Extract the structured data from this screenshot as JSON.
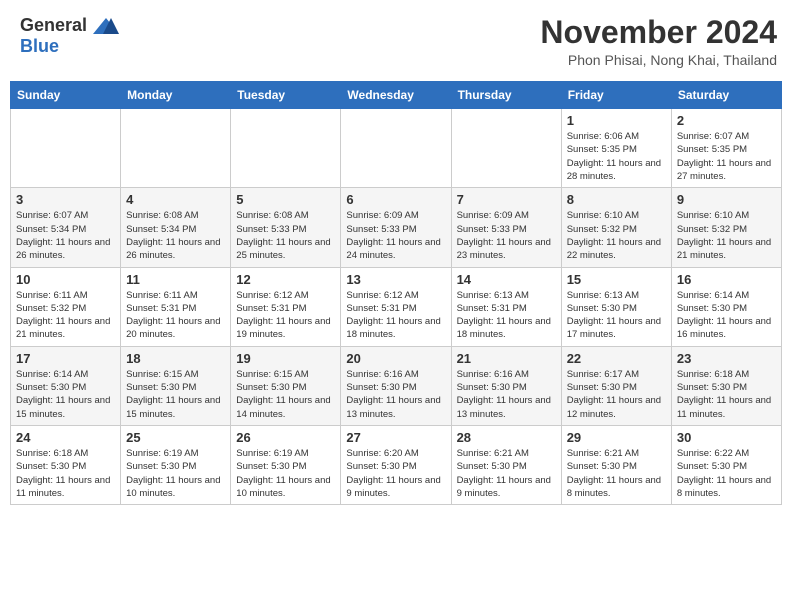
{
  "header": {
    "logo_general": "General",
    "logo_blue": "Blue",
    "month": "November 2024",
    "location": "Phon Phisai, Nong Khai, Thailand"
  },
  "days_of_week": [
    "Sunday",
    "Monday",
    "Tuesday",
    "Wednesday",
    "Thursday",
    "Friday",
    "Saturday"
  ],
  "weeks": [
    [
      {
        "day": "",
        "info": ""
      },
      {
        "day": "",
        "info": ""
      },
      {
        "day": "",
        "info": ""
      },
      {
        "day": "",
        "info": ""
      },
      {
        "day": "",
        "info": ""
      },
      {
        "day": "1",
        "info": "Sunrise: 6:06 AM\nSunset: 5:35 PM\nDaylight: 11 hours and 28 minutes."
      },
      {
        "day": "2",
        "info": "Sunrise: 6:07 AM\nSunset: 5:35 PM\nDaylight: 11 hours and 27 minutes."
      }
    ],
    [
      {
        "day": "3",
        "info": "Sunrise: 6:07 AM\nSunset: 5:34 PM\nDaylight: 11 hours and 26 minutes."
      },
      {
        "day": "4",
        "info": "Sunrise: 6:08 AM\nSunset: 5:34 PM\nDaylight: 11 hours and 26 minutes."
      },
      {
        "day": "5",
        "info": "Sunrise: 6:08 AM\nSunset: 5:33 PM\nDaylight: 11 hours and 25 minutes."
      },
      {
        "day": "6",
        "info": "Sunrise: 6:09 AM\nSunset: 5:33 PM\nDaylight: 11 hours and 24 minutes."
      },
      {
        "day": "7",
        "info": "Sunrise: 6:09 AM\nSunset: 5:33 PM\nDaylight: 11 hours and 23 minutes."
      },
      {
        "day": "8",
        "info": "Sunrise: 6:10 AM\nSunset: 5:32 PM\nDaylight: 11 hours and 22 minutes."
      },
      {
        "day": "9",
        "info": "Sunrise: 6:10 AM\nSunset: 5:32 PM\nDaylight: 11 hours and 21 minutes."
      }
    ],
    [
      {
        "day": "10",
        "info": "Sunrise: 6:11 AM\nSunset: 5:32 PM\nDaylight: 11 hours and 21 minutes."
      },
      {
        "day": "11",
        "info": "Sunrise: 6:11 AM\nSunset: 5:31 PM\nDaylight: 11 hours and 20 minutes."
      },
      {
        "day": "12",
        "info": "Sunrise: 6:12 AM\nSunset: 5:31 PM\nDaylight: 11 hours and 19 minutes."
      },
      {
        "day": "13",
        "info": "Sunrise: 6:12 AM\nSunset: 5:31 PM\nDaylight: 11 hours and 18 minutes."
      },
      {
        "day": "14",
        "info": "Sunrise: 6:13 AM\nSunset: 5:31 PM\nDaylight: 11 hours and 18 minutes."
      },
      {
        "day": "15",
        "info": "Sunrise: 6:13 AM\nSunset: 5:30 PM\nDaylight: 11 hours and 17 minutes."
      },
      {
        "day": "16",
        "info": "Sunrise: 6:14 AM\nSunset: 5:30 PM\nDaylight: 11 hours and 16 minutes."
      }
    ],
    [
      {
        "day": "17",
        "info": "Sunrise: 6:14 AM\nSunset: 5:30 PM\nDaylight: 11 hours and 15 minutes."
      },
      {
        "day": "18",
        "info": "Sunrise: 6:15 AM\nSunset: 5:30 PM\nDaylight: 11 hours and 15 minutes."
      },
      {
        "day": "19",
        "info": "Sunrise: 6:15 AM\nSunset: 5:30 PM\nDaylight: 11 hours and 14 minutes."
      },
      {
        "day": "20",
        "info": "Sunrise: 6:16 AM\nSunset: 5:30 PM\nDaylight: 11 hours and 13 minutes."
      },
      {
        "day": "21",
        "info": "Sunrise: 6:16 AM\nSunset: 5:30 PM\nDaylight: 11 hours and 13 minutes."
      },
      {
        "day": "22",
        "info": "Sunrise: 6:17 AM\nSunset: 5:30 PM\nDaylight: 11 hours and 12 minutes."
      },
      {
        "day": "23",
        "info": "Sunrise: 6:18 AM\nSunset: 5:30 PM\nDaylight: 11 hours and 11 minutes."
      }
    ],
    [
      {
        "day": "24",
        "info": "Sunrise: 6:18 AM\nSunset: 5:30 PM\nDaylight: 11 hours and 11 minutes."
      },
      {
        "day": "25",
        "info": "Sunrise: 6:19 AM\nSunset: 5:30 PM\nDaylight: 11 hours and 10 minutes."
      },
      {
        "day": "26",
        "info": "Sunrise: 6:19 AM\nSunset: 5:30 PM\nDaylight: 11 hours and 10 minutes."
      },
      {
        "day": "27",
        "info": "Sunrise: 6:20 AM\nSunset: 5:30 PM\nDaylight: 11 hours and 9 minutes."
      },
      {
        "day": "28",
        "info": "Sunrise: 6:21 AM\nSunset: 5:30 PM\nDaylight: 11 hours and 9 minutes."
      },
      {
        "day": "29",
        "info": "Sunrise: 6:21 AM\nSunset: 5:30 PM\nDaylight: 11 hours and 8 minutes."
      },
      {
        "day": "30",
        "info": "Sunrise: 6:22 AM\nSunset: 5:30 PM\nDaylight: 11 hours and 8 minutes."
      }
    ]
  ]
}
